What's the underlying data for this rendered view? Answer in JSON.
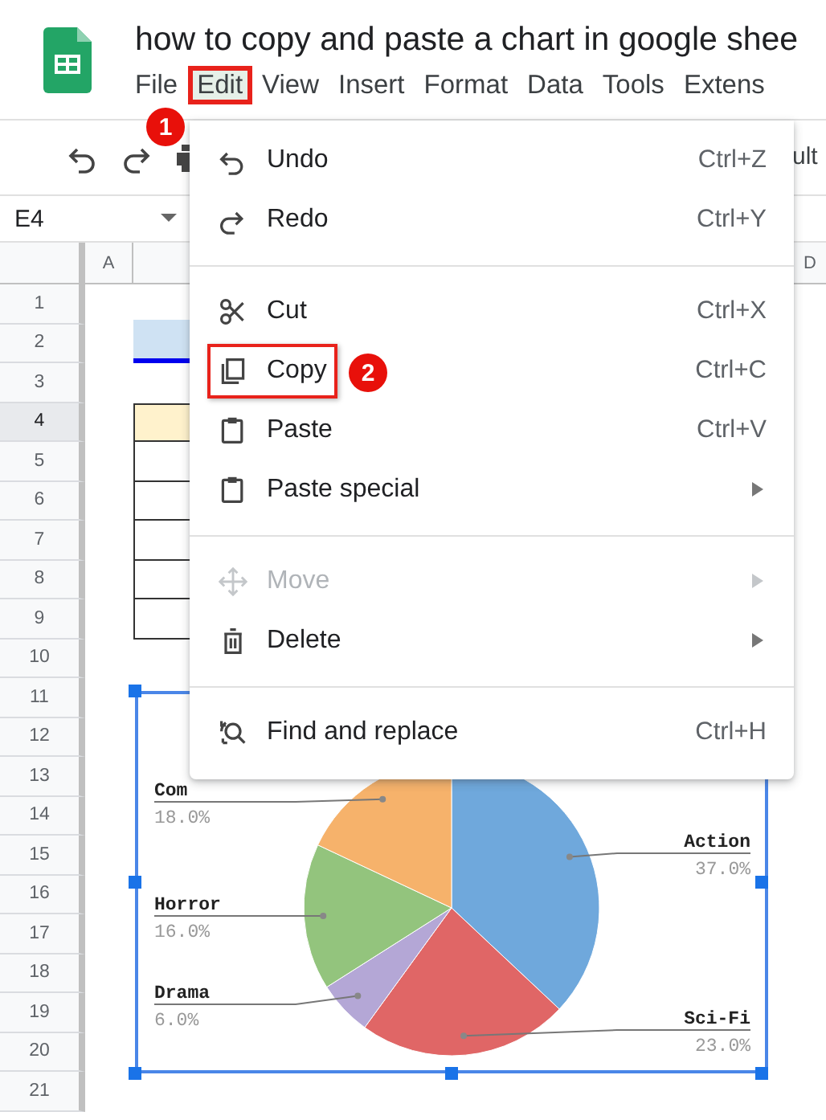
{
  "app": {
    "title": "how to copy and paste a chart in google shee"
  },
  "menu_bar": [
    {
      "label": "File",
      "selected": false,
      "outlined": false
    },
    {
      "label": "Edit",
      "selected": true,
      "outlined": true
    },
    {
      "label": "View",
      "selected": false,
      "outlined": false
    },
    {
      "label": "Insert",
      "selected": false,
      "outlined": false
    },
    {
      "label": "Format",
      "selected": false,
      "outlined": false
    },
    {
      "label": "Data",
      "selected": false,
      "outlined": false
    },
    {
      "label": "Tools",
      "selected": false,
      "outlined": false
    },
    {
      "label": "Extens",
      "selected": false,
      "outlined": false
    }
  ],
  "toolbar": {
    "font_text": "ult"
  },
  "name_box": {
    "value": "E4"
  },
  "column_headers": [
    {
      "label": "A"
    },
    {
      "label": "D"
    }
  ],
  "rows": [
    {
      "label": "1",
      "selected": false
    },
    {
      "label": "2",
      "selected": false
    },
    {
      "label": "3",
      "selected": false
    },
    {
      "label": "4",
      "selected": true
    },
    {
      "label": "5",
      "selected": false
    },
    {
      "label": "6",
      "selected": false
    },
    {
      "label": "7",
      "selected": false
    },
    {
      "label": "8",
      "selected": false
    },
    {
      "label": "9",
      "selected": false
    },
    {
      "label": "10",
      "selected": false
    },
    {
      "label": "11",
      "selected": false
    },
    {
      "label": "12",
      "selected": false
    },
    {
      "label": "13",
      "selected": false
    },
    {
      "label": "14",
      "selected": false
    },
    {
      "label": "15",
      "selected": false
    },
    {
      "label": "16",
      "selected": false
    },
    {
      "label": "17",
      "selected": false
    },
    {
      "label": "18",
      "selected": false
    },
    {
      "label": "19",
      "selected": false
    },
    {
      "label": "20",
      "selected": false
    },
    {
      "label": "21",
      "selected": false
    }
  ],
  "edit_menu": {
    "items": [
      {
        "kind": "item",
        "label": "Undo",
        "shortcut": "Ctrl+Z",
        "disabled": false,
        "submenu": false,
        "outlined": false
      },
      {
        "kind": "item",
        "label": "Redo",
        "shortcut": "Ctrl+Y",
        "disabled": false,
        "submenu": false,
        "outlined": false
      },
      {
        "kind": "divider"
      },
      {
        "kind": "item",
        "label": "Cut",
        "shortcut": "Ctrl+X",
        "disabled": false,
        "submenu": false,
        "outlined": false
      },
      {
        "kind": "item",
        "label": "Copy",
        "shortcut": "Ctrl+C",
        "disabled": false,
        "submenu": false,
        "outlined": true
      },
      {
        "kind": "item",
        "label": "Paste",
        "shortcut": "Ctrl+V",
        "disabled": false,
        "submenu": false,
        "outlined": false
      },
      {
        "kind": "item",
        "label": "Paste special",
        "disabled": false,
        "submenu": true,
        "outlined": false
      },
      {
        "kind": "divider"
      },
      {
        "kind": "item",
        "label": "Move",
        "disabled": true,
        "submenu": true,
        "outlined": false
      },
      {
        "kind": "item",
        "label": "Delete",
        "disabled": false,
        "submenu": true,
        "outlined": false
      },
      {
        "kind": "divider"
      },
      {
        "kind": "item",
        "label": "Find and replace",
        "shortcut": "Ctrl+H",
        "disabled": false,
        "submenu": false,
        "outlined": false
      }
    ]
  },
  "chart": {
    "chart_data": {
      "type": "pie",
      "categories": [
        "Action",
        "Sci-Fi",
        "Drama",
        "Horror",
        "Com"
      ],
      "values": [
        37,
        23,
        6,
        16,
        18
      ],
      "colors": [
        "#6fa8dc",
        "#e06666",
        "#b4a7d6",
        "#93c47d",
        "#f6b26b"
      ],
      "value_labels": [
        "37.0%",
        "23.0%",
        "6.0%",
        "16.0%",
        "18.0%"
      ]
    }
  },
  "callouts": [
    {
      "number": "1"
    },
    {
      "number": "2"
    }
  ]
}
